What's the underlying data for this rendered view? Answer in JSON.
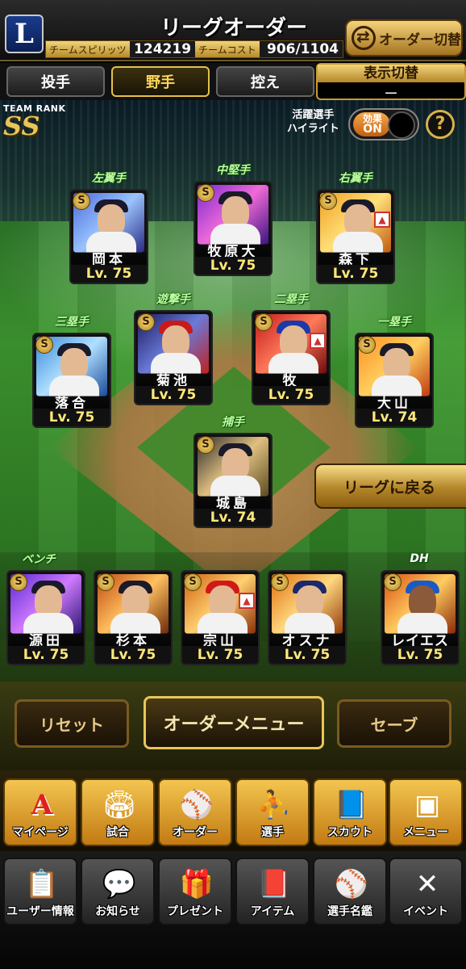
{
  "header": {
    "team_logo_letter": "L",
    "title": "リーグオーダー",
    "team_spirit_label": "チームスピリッツ",
    "team_spirit_value": "124219",
    "team_cost_label": "チームコスト",
    "team_cost_value": "906/1104",
    "order_switch_label": "オーダー切替"
  },
  "tabs": [
    {
      "label": "投手",
      "active": false
    },
    {
      "label": "野手",
      "active": true
    },
    {
      "label": "控え",
      "active": false
    }
  ],
  "display_switch": {
    "label": "表示切替",
    "value": "ー"
  },
  "field": {
    "team_rank_label": "TEAM RANK",
    "team_rank_value": "SS",
    "highlight_label": "活躍選手\nハイライト",
    "effect_label": "効果",
    "effect_state": "ON",
    "help_label": "?",
    "return_button": "リーグに戻る"
  },
  "positions": {
    "lf": "左翼手",
    "cf": "中堅手",
    "rf": "右翼手",
    "ss": "遊撃手",
    "second": "二塁手",
    "third": "三塁手",
    "first": "一塁手",
    "catcher": "捕手",
    "bench": "ベンチ",
    "dh": "DH"
  },
  "players": {
    "lf": {
      "name": "岡本",
      "level": "Lv. 75",
      "badge": "S"
    },
    "cf": {
      "name": "牧原大",
      "level": "Lv. 75",
      "badge": "S"
    },
    "rf": {
      "name": "森下",
      "level": "Lv. 75",
      "badge": "S"
    },
    "ss": {
      "name": "菊池",
      "level": "Lv. 75",
      "badge": "S"
    },
    "second": {
      "name": "牧",
      "level": "Lv. 75",
      "badge": "S"
    },
    "third": {
      "name": "落合",
      "level": "Lv. 75",
      "badge": "S"
    },
    "first": {
      "name": "大山",
      "level": "Lv. 74",
      "badge": "S"
    },
    "catcher": {
      "name": "城島",
      "level": "Lv. 74",
      "badge": "S"
    },
    "bench1": {
      "name": "源田",
      "level": "Lv. 75",
      "badge": "S"
    },
    "bench2": {
      "name": "杉本",
      "level": "Lv. 75",
      "badge": "S"
    },
    "bench3": {
      "name": "宗山",
      "level": "Lv. 75",
      "badge": "S"
    },
    "bench4": {
      "name": "オスナ",
      "level": "Lv. 75",
      "badge": "S"
    },
    "dh": {
      "name": "レイエス",
      "level": "Lv. 75",
      "badge": "S"
    }
  },
  "controls": {
    "reset": "リセット",
    "order_menu": "オーダーメニュー",
    "save": "セーブ"
  },
  "nav_primary": [
    {
      "label": "マイページ",
      "icon": "mypage-icon"
    },
    {
      "label": "試合",
      "icon": "stadium-icon"
    },
    {
      "label": "オーダー",
      "icon": "order-icon"
    },
    {
      "label": "選手",
      "icon": "player-icon"
    },
    {
      "label": "スカウト",
      "icon": "scout-icon"
    },
    {
      "label": "メニュー",
      "icon": "menu-icon"
    }
  ],
  "nav_secondary": [
    {
      "label": "ユーザー情報",
      "icon": "user-info-icon"
    },
    {
      "label": "お知らせ",
      "icon": "news-icon"
    },
    {
      "label": "プレゼント",
      "icon": "present-icon"
    },
    {
      "label": "アイテム",
      "icon": "item-icon"
    },
    {
      "label": "選手名鑑",
      "icon": "player-book-icon"
    },
    {
      "label": "イベント",
      "icon": "event-icon"
    }
  ],
  "colors": {
    "accent_gold": "#e4c14a",
    "level_text": "#ffe87a",
    "field_green": "#3f9a30"
  }
}
